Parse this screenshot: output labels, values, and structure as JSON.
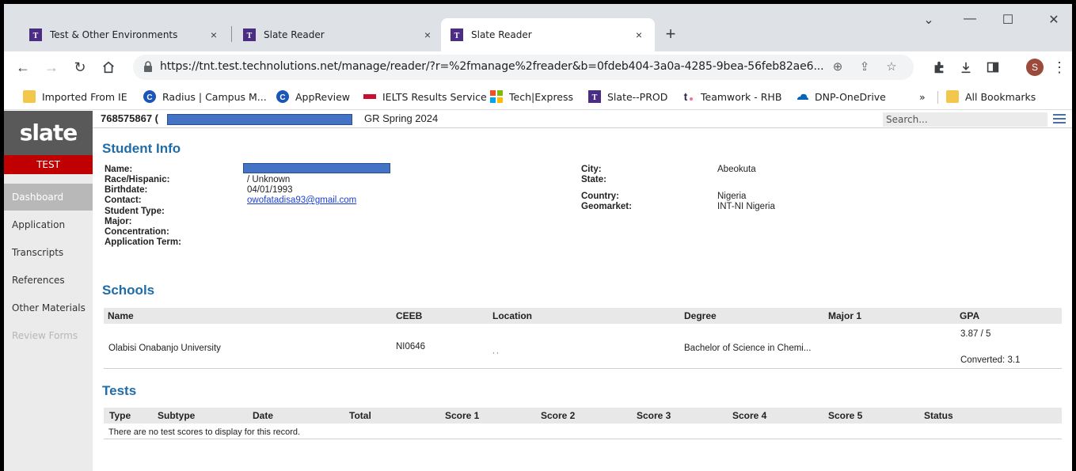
{
  "browser": {
    "tabs": [
      {
        "title": "Test & Other Environments",
        "close": "×"
      },
      {
        "title": "Slate Reader",
        "close": "×"
      },
      {
        "title": "Slate Reader",
        "close": "×"
      }
    ],
    "new_tab": "+",
    "window_controls": {
      "minimize": "—",
      "maximize": "☐",
      "close": "✕",
      "tab_search": "⌄"
    },
    "url": "https://tnt.test.technolutions.net/manage/reader/?r=%2fmanage%2freader&b=0fdeb404-3a0a-4285-9bea-56feb82ae6...",
    "profile_initial": "S",
    "bookmarks": [
      {
        "label": "Imported From IE",
        "icon": "folder-icon"
      },
      {
        "label": "Radius | Campus M...",
        "icon": "radius-icon"
      },
      {
        "label": "AppReview",
        "icon": "radius-icon"
      },
      {
        "label": "IELTS Results Service",
        "icon": "ielts-icon"
      },
      {
        "label": "Tech|Express",
        "icon": "microsoft-icon"
      },
      {
        "label": "Slate--PROD",
        "icon": "slate-icon"
      },
      {
        "label": "Teamwork - RHB",
        "icon": "teamwork-icon"
      },
      {
        "label": "DNP-OneDrive",
        "icon": "onedrive-icon"
      }
    ],
    "bookmarks_overflow": "»",
    "all_bookmarks": "All Bookmarks"
  },
  "app": {
    "logo": "slate",
    "environment": "TEST",
    "nav": [
      "Dashboard",
      "Application",
      "Transcripts",
      "References",
      "Other Materials",
      "Review Forms"
    ],
    "record_id": "768575867 (",
    "record_term": "GR Spring 2024",
    "search_placeholder": "Search..."
  },
  "student_info": {
    "heading": "Student Info",
    "left_labels": [
      "Name:",
      "Race/Hispanic:",
      "Birthdate:",
      "Contact:",
      "Student Type:",
      "Major:",
      "Concentration:",
      "Application Term:"
    ],
    "race": "/ Unknown",
    "birthdate": "04/01/1993",
    "email": "owofatadisa93@gmail.com",
    "right_labels": [
      "City:",
      "State:",
      "Country:",
      "Geomarket:"
    ],
    "city": "Abeokuta",
    "country": "Nigeria",
    "geomarket": "INT-NI Nigeria"
  },
  "schools": {
    "heading": "Schools",
    "columns": [
      "Name",
      "CEEB",
      "Location",
      "Degree",
      "Major 1",
      "GPA"
    ],
    "rows": [
      {
        "name": "Olabisi Onabanjo University",
        "ceeb": "NI0646",
        "location": ", ,",
        "degree": "Bachelor of Science in Chemi...",
        "major": "",
        "gpa": "3.87 / 5",
        "converted": "Converted: 3.1"
      }
    ]
  },
  "tests": {
    "heading": "Tests",
    "columns": [
      "Type",
      "Subtype",
      "Date",
      "Total",
      "Score 1",
      "Score 2",
      "Score 3",
      "Score 4",
      "Score 5",
      "Status"
    ],
    "empty_message": "There are no test scores to display for this record."
  }
}
